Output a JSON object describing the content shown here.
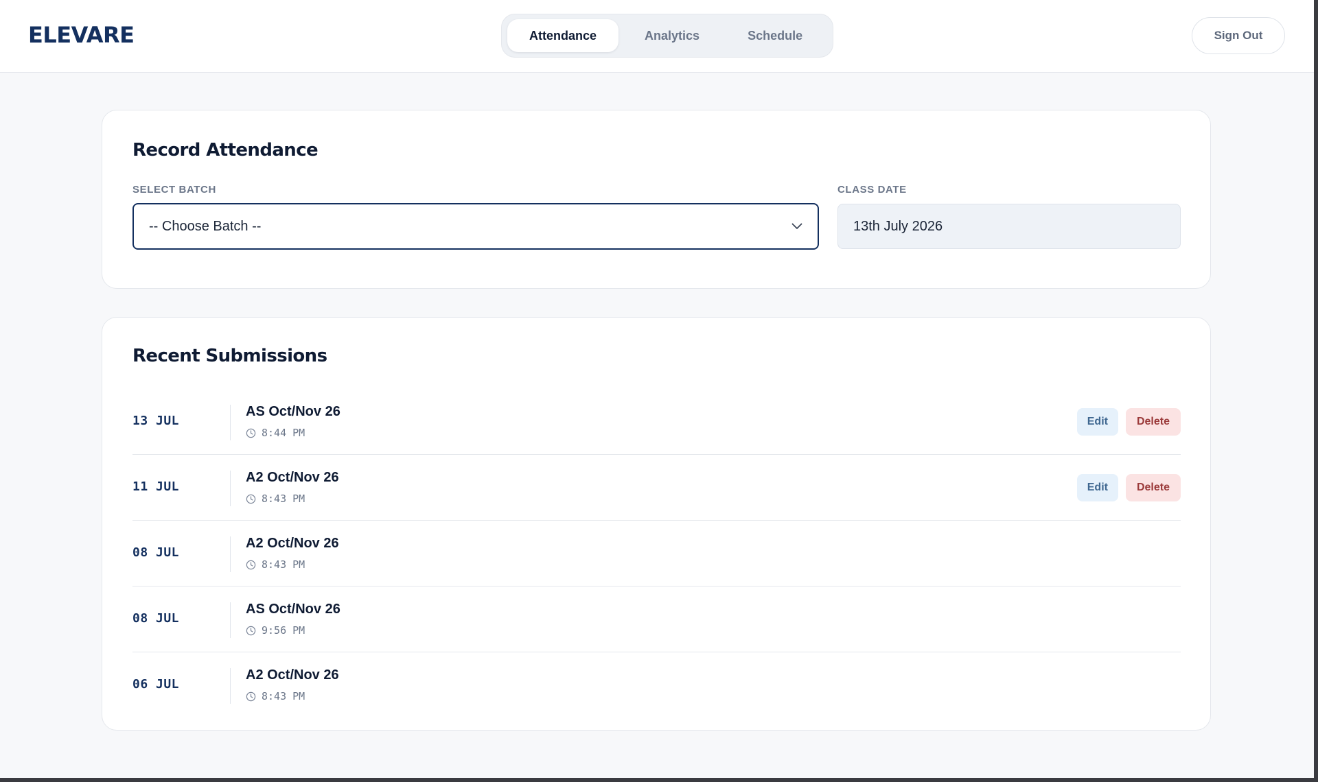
{
  "app": {
    "logo": "ELEVARE"
  },
  "nav": {
    "tabs": [
      {
        "label": "Attendance",
        "active": true
      },
      {
        "label": "Analytics",
        "active": false
      },
      {
        "label": "Schedule",
        "active": false
      }
    ],
    "signout_label": "Sign Out"
  },
  "record": {
    "title": "Record Attendance",
    "batch_label": "SELECT BATCH",
    "batch_value": "-- Choose Batch --",
    "date_label": "CLASS DATE",
    "date_value": "13th July 2026"
  },
  "recent": {
    "title": "Recent Submissions",
    "edit_label": "Edit",
    "delete_label": "Delete",
    "rows": [
      {
        "date": "13 JUL",
        "batch": "AS Oct/Nov 26",
        "time": "8:44 PM",
        "actions": true
      },
      {
        "date": "11 JUL",
        "batch": "A2 Oct/Nov 26",
        "time": "8:43 PM",
        "actions": true
      },
      {
        "date": "08 JUL",
        "batch": "A2 Oct/Nov 26",
        "time": "8:43 PM",
        "actions": false
      },
      {
        "date": "08 JUL",
        "batch": "AS Oct/Nov 26",
        "time": "9:56 PM",
        "actions": false
      },
      {
        "date": "06 JUL",
        "batch": "A2 Oct/Nov 26",
        "time": "8:43 PM",
        "actions": false
      }
    ]
  },
  "colors": {
    "brand": "#14305f",
    "edit_bg": "#e6f1fb",
    "delete_bg": "#fbe3e3",
    "page_bg": "#f7f8fa"
  },
  "icons": {
    "dropdown": "chevron-down-icon",
    "time": "clock-icon"
  }
}
